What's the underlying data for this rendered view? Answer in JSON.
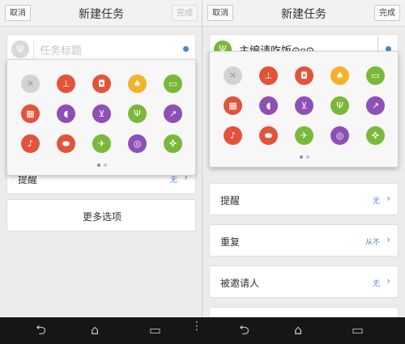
{
  "topbar": {
    "cancel_label": "取消",
    "title": "新建任务",
    "done_label": "完成"
  },
  "left": {
    "title_placeholder": "任务标题",
    "category_icon": "fork-knife-icon",
    "rows": [
      {
        "label": "提醒",
        "value": "无"
      }
    ],
    "more_label": "更多选项"
  },
  "right": {
    "title_value": "主编请吃饭⊙▿⊙",
    "category_icon": "fork-knife-icon",
    "rows": [
      {
        "label": "提醒",
        "value": "无"
      },
      {
        "label": "重复",
        "value": "从不"
      },
      {
        "label": "被邀请人",
        "value": "无"
      }
    ]
  },
  "category_icons": [
    {
      "name": "clear-icon",
      "glyph": "✕",
      "color": "#d3d3d3",
      "text": "#9a9a9a"
    },
    {
      "name": "stamp-icon",
      "glyph": "⊥",
      "color": "#e2533b",
      "text": "#ffffff"
    },
    {
      "name": "car-icon",
      "glyph": "◘",
      "color": "#e2533b",
      "text": "#ffffff"
    },
    {
      "name": "card-icon",
      "glyph": "♠",
      "color": "#f4b22b",
      "text": "#ffffff"
    },
    {
      "name": "visa-icon",
      "glyph": "▭",
      "color": "#7ab83a",
      "text": "#ffffff"
    },
    {
      "name": "gift-icon",
      "glyph": "▦",
      "color": "#e2533b",
      "text": "#ffffff"
    },
    {
      "name": "hairdryer-icon",
      "glyph": "◖",
      "color": "#8e4fb6",
      "text": "#ffffff"
    },
    {
      "name": "cart-icon",
      "glyph": "⊻",
      "color": "#8e4fb6",
      "text": "#ffffff"
    },
    {
      "name": "fork-knife-icon",
      "glyph": "Ψ",
      "color": "#7ab83a",
      "text": "#ffffff"
    },
    {
      "name": "chart-icon",
      "glyph": "↗",
      "color": "#8e4fb6",
      "text": "#ffffff"
    },
    {
      "name": "music-icon",
      "glyph": "♪",
      "color": "#e2533b",
      "text": "#ffffff"
    },
    {
      "name": "pill-icon",
      "glyph": "⬬",
      "color": "#e2533b",
      "text": "#ffffff"
    },
    {
      "name": "plane-icon",
      "glyph": "✈",
      "color": "#7ab83a",
      "text": "#ffffff"
    },
    {
      "name": "ring-icon",
      "glyph": "◎",
      "color": "#8e4fb6",
      "text": "#ffffff"
    },
    {
      "name": "runner-icon",
      "glyph": "✜",
      "color": "#7ab83a",
      "text": "#ffffff"
    }
  ],
  "pager": {
    "pages": 2,
    "active": 0
  },
  "navbar": {
    "back_icon": "back-icon",
    "home_icon": "home-icon",
    "recents_icon": "recents-icon",
    "menu_icon": "menu-dots-icon"
  },
  "colors": {
    "link_blue": "#5a86c4",
    "dot_blue": "#4c86c9",
    "green": "#7ab83a"
  }
}
